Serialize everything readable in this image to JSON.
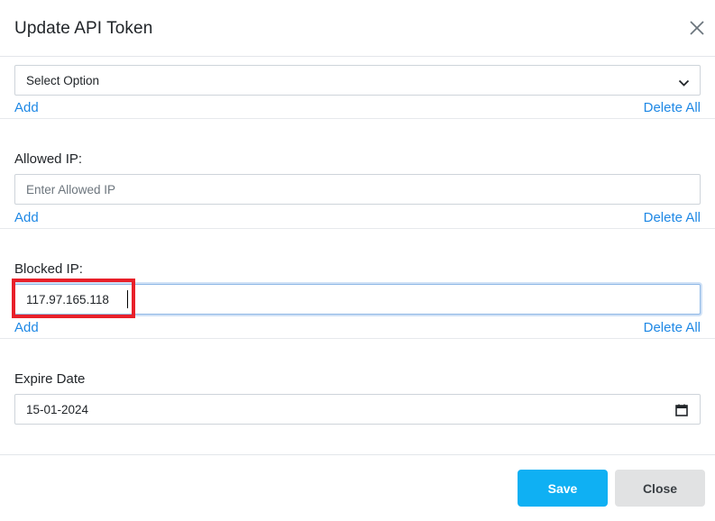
{
  "modal": {
    "title": "Update API Token"
  },
  "select_option": {
    "value": "Select Option",
    "add_label": "Add",
    "delete_all_label": "Delete All"
  },
  "allowed_ip": {
    "label": "Allowed IP:",
    "placeholder": "Enter Allowed IP",
    "value": "",
    "add_label": "Add",
    "delete_all_label": "Delete All"
  },
  "blocked_ip": {
    "label": "Blocked IP:",
    "value": "117.97.165.118",
    "add_label": "Add",
    "delete_all_label": "Delete All"
  },
  "expire_date": {
    "label": "Expire Date",
    "value": "15-01-2024"
  },
  "footer": {
    "save_label": "Save",
    "close_label": "Close"
  },
  "colors": {
    "link": "#1e88e5",
    "save_button": "#0fb0f3",
    "close_button": "#e1e2e3",
    "highlight": "#e8202a",
    "focus_border": "#8fb8e6"
  },
  "icons": {
    "close": "close-icon",
    "dropdown": "chevron-down-icon",
    "calendar": "calendar-icon"
  }
}
